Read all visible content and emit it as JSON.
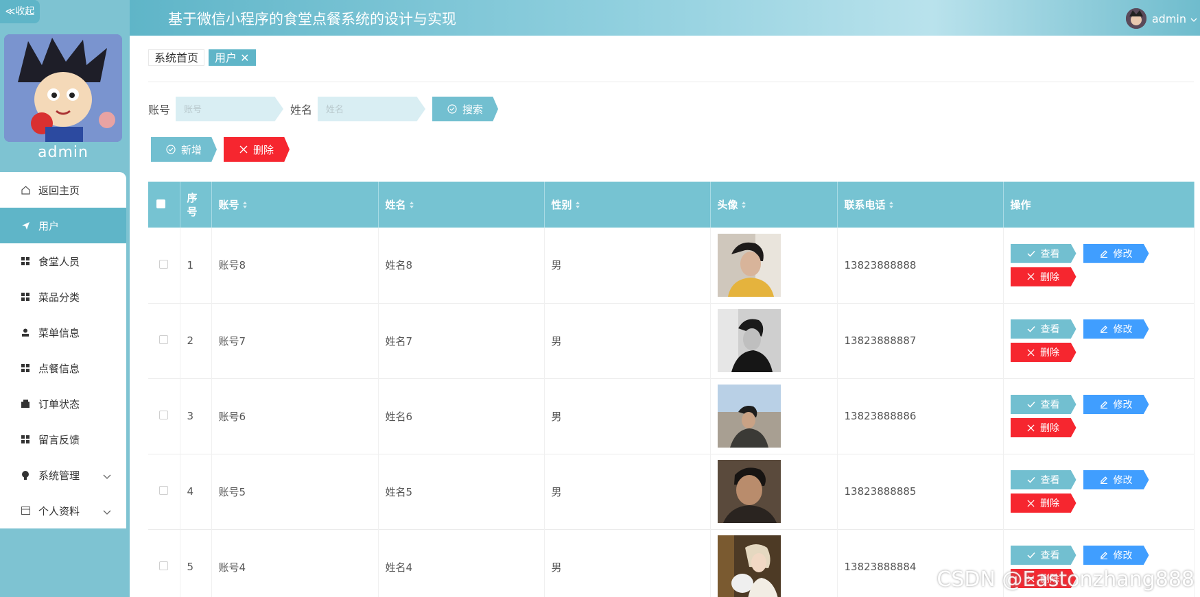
{
  "sidebar": {
    "collapse_label": "≪收起",
    "admin_name": "admin",
    "items": [
      {
        "label": "返回主页",
        "icon": "home-icon"
      },
      {
        "label": "用户",
        "icon": "send-icon",
        "active": true
      },
      {
        "label": "食堂人员",
        "icon": "grid-icon"
      },
      {
        "label": "菜品分类",
        "icon": "grid-icon"
      },
      {
        "label": "菜单信息",
        "icon": "person-icon"
      },
      {
        "label": "点餐信息",
        "icon": "grid-icon"
      },
      {
        "label": "订单状态",
        "icon": "wallet-icon"
      },
      {
        "label": "留言反馈",
        "icon": "grid-icon"
      },
      {
        "label": "系统管理",
        "icon": "bulb-icon",
        "expandable": true
      },
      {
        "label": "个人资料",
        "icon": "card-icon",
        "expandable": true
      }
    ]
  },
  "header": {
    "title": "基于微信小程序的食堂点餐系统的设计与实现",
    "user": "admin"
  },
  "tags": {
    "home": "系统首页",
    "current": "用户 ✕"
  },
  "search": {
    "account_label": "账号",
    "account_placeholder": "账号",
    "name_label": "姓名",
    "name_placeholder": "姓名",
    "search_label": "搜索"
  },
  "actions": {
    "add_label": "新增",
    "delete_label": "删除"
  },
  "table": {
    "headers": [
      "序号",
      "账号",
      "姓名",
      "性别",
      "头像",
      "联系电话",
      "操作"
    ],
    "rows": [
      {
        "no": "1",
        "account": "账号8",
        "name": "姓名8",
        "gender": "男",
        "phone": "13823888888"
      },
      {
        "no": "2",
        "account": "账号7",
        "name": "姓名7",
        "gender": "男",
        "phone": "13823888887"
      },
      {
        "no": "3",
        "account": "账号6",
        "name": "姓名6",
        "gender": "男",
        "phone": "13823888886"
      },
      {
        "no": "4",
        "account": "账号5",
        "name": "姓名5",
        "gender": "男",
        "phone": "13823888885"
      },
      {
        "no": "5",
        "account": "账号4",
        "name": "姓名4",
        "gender": "男",
        "phone": "13823888884"
      }
    ],
    "op_view": "查看",
    "op_edit": "修改",
    "op_delete": "删除"
  },
  "watermark": "CSDN @Eastonzhang888",
  "colors": {
    "accent": "#5fb5c8",
    "danger": "#f6262f",
    "edit": "#409eff"
  }
}
